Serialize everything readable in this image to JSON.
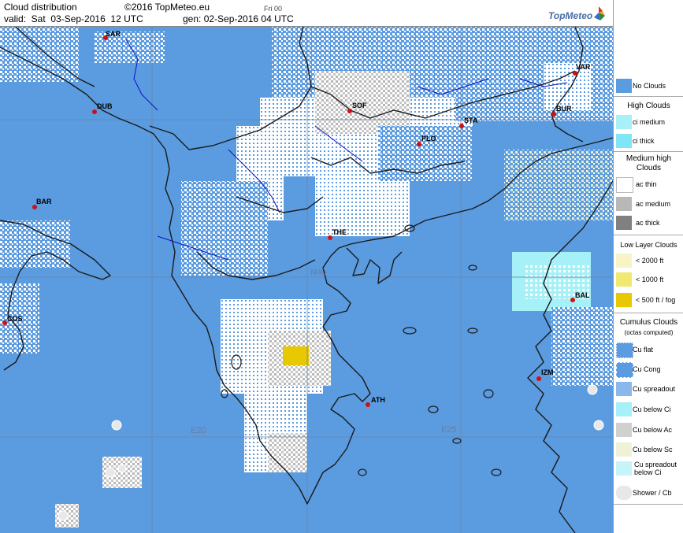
{
  "header": {
    "title": "Cloud distribution",
    "copyright": "©2016 TopMeteo.eu",
    "forecast_day": "Fri 00",
    "valid": "valid:  Sat  03-Sep-2016  12 UTC",
    "generated": "gen: 02-Sep-2016 04 UTC",
    "logo": "TopMeteo"
  },
  "map": {
    "sea_color": "#5b9be0",
    "cities": [
      {
        "code": "SAR"
      },
      {
        "code": "DUB"
      },
      {
        "code": "BAR"
      },
      {
        "code": "COS"
      },
      {
        "code": "SOF"
      },
      {
        "code": "PLO"
      },
      {
        "code": "STA"
      },
      {
        "code": "VAR"
      },
      {
        "code": "BUR"
      },
      {
        "code": "THE"
      },
      {
        "code": "BAL"
      },
      {
        "code": "IZM"
      },
      {
        "code": "ATH"
      }
    ],
    "grid_labels": [
      "N40",
      "E20",
      "E25"
    ]
  },
  "legend": {
    "no_clouds": "No Clouds",
    "high_clouds": "High Clouds",
    "ci_medium": "ci medium",
    "ci_thick": "ci thick",
    "medium_high": "Medium high Clouds",
    "ac_thin": "ac thin",
    "ac_medium": "ac medium",
    "ac_thick": "ac thick",
    "low_layer": "Low Layer Clouds",
    "lt2000": "< 2000 ft",
    "lt1000": "< 1000 ft",
    "lt500": "< 500 ft / fog",
    "cumulus": "Cumulus Clouds",
    "octas": "(octas computed)",
    "cu_flat": "Cu flat",
    "cu_cong": "Cu Cong",
    "cu_spreadout": "Cu spreadout",
    "cu_below_ci": "Cu below Ci",
    "cu_below_ac": "Cu below Ac",
    "cu_below_sc": "Cu below Sc",
    "cu_spreadout_below_ci": "Cu spreadout below Ci",
    "shower": "Shower / Cb"
  }
}
